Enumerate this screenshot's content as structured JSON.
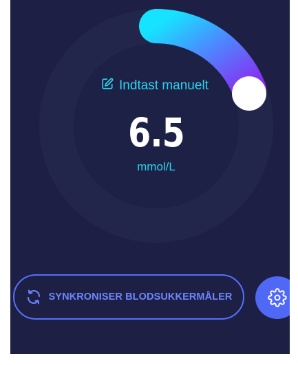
{
  "glucose": {
    "manual_entry_label": "Indtast manuelt",
    "value": "6.5",
    "unit": "mmol/L"
  },
  "actions": {
    "sync_label": "SYNKRONISER BLODSUKKERMÅLER"
  },
  "icons": {
    "manual_entry": "pencil-edit-icon",
    "sync": "sync-arrows-icon",
    "settings": "gear-icon"
  },
  "colors": {
    "background": "#1d2044",
    "accent_cyan": "#2ad4ee",
    "accent_blue": "#5068f6",
    "gauge_gradient_start": "#16e3ff",
    "gauge_gradient_end": "#8a2cf0"
  }
}
